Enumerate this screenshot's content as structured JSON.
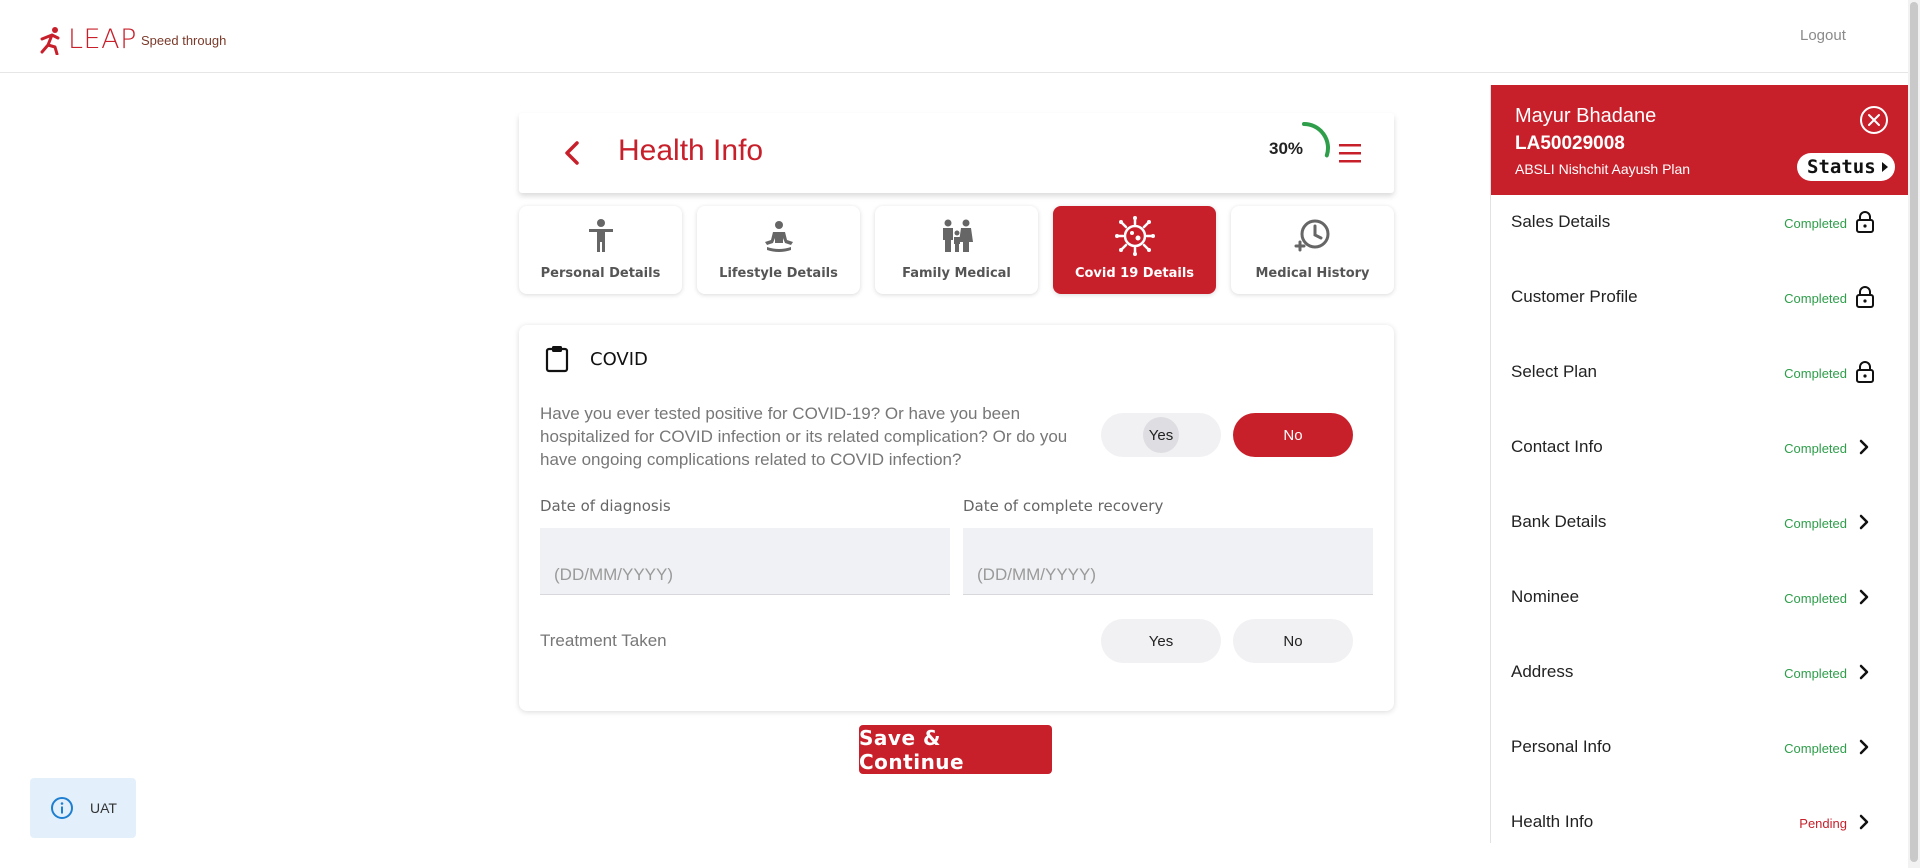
{
  "brand": {
    "name": "LEAP",
    "tagline": "Speed through",
    "color": "#c8202b"
  },
  "topbar": {
    "logout_label": "Logout"
  },
  "header": {
    "title": "Health Info",
    "progress_label": "30%",
    "progress_percent": 30
  },
  "tabs": [
    {
      "label": "Personal Details",
      "icon": "person-icon",
      "active": false
    },
    {
      "label": "Lifestyle Details",
      "icon": "meditation-icon",
      "active": false
    },
    {
      "label": "Family Medical",
      "icon": "family-icon",
      "active": false
    },
    {
      "label": "Covid 19 Details",
      "icon": "virus-icon",
      "active": true
    },
    {
      "label": "Medical History",
      "icon": "history-icon",
      "active": false
    }
  ],
  "covid": {
    "section_title": "COVID",
    "question": "Have you ever tested positive for COVID-19? Or have you been hospitalized for COVID infection or its related complication? Or do you have ongoing complications related to COVID infection?",
    "yes_label": "Yes",
    "no_label": "No",
    "selected": "No",
    "diagnosis_label": "Date of diagnosis",
    "diagnosis_placeholder": "(DD/MM/YYYY)",
    "recovery_label": "Date of complete recovery",
    "recovery_placeholder": "(DD/MM/YYYY)",
    "treatment_label": "Treatment Taken",
    "treatment_yes": "Yes",
    "treatment_no": "No"
  },
  "actions": {
    "save_label": "Save & Continue"
  },
  "env_badge": {
    "label": "UAT"
  },
  "panel": {
    "name": "Mayur Bhadane",
    "application_id": "LA50029008",
    "plan": "ABSLI Nishchit Aayush Plan",
    "status_label": "Status",
    "steps": [
      {
        "label": "Sales Details",
        "status": "Completed",
        "icon": "lock-icon"
      },
      {
        "label": "Customer Profile",
        "status": "Completed",
        "icon": "lock-icon"
      },
      {
        "label": "Select Plan",
        "status": "Completed",
        "icon": "lock-icon"
      },
      {
        "label": "Contact Info",
        "status": "Completed",
        "icon": "chevron-right-icon"
      },
      {
        "label": "Bank Details",
        "status": "Completed",
        "icon": "chevron-right-icon"
      },
      {
        "label": "Nominee",
        "status": "Completed",
        "icon": "chevron-right-icon"
      },
      {
        "label": "Address",
        "status": "Completed",
        "icon": "chevron-right-icon"
      },
      {
        "label": "Personal Info",
        "status": "Completed",
        "icon": "chevron-right-icon"
      },
      {
        "label": "Health Info",
        "status": "Pending",
        "icon": "chevron-right-icon"
      }
    ],
    "completed_color": "#2e9e4a",
    "pending_color": "#c8202b"
  }
}
